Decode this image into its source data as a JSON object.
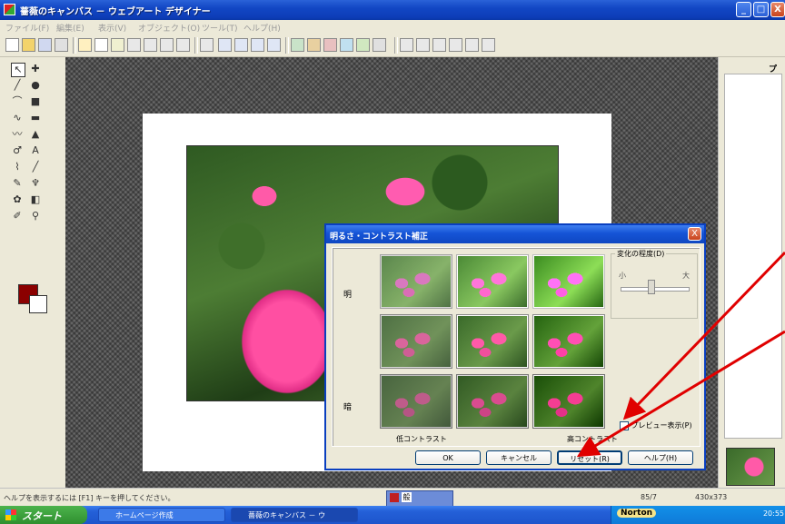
{
  "window": {
    "title": "薔薇のキャンバス － ウェブアート デザイナー",
    "controls": {
      "minimize": "_",
      "maximize": "□",
      "close": "X"
    }
  },
  "menu": [
    "ファイル(F)",
    "編集(E)",
    "表示(V)",
    "オブジェクト(O)",
    "ツール(T)",
    "ヘルプ(H)"
  ],
  "right_panel": {
    "label": "プ"
  },
  "dialog": {
    "title": "明るさ・コントラスト補正",
    "close": "X",
    "row_labels": [
      "明",
      "",
      "暗"
    ],
    "axis_low": "低コントラスト",
    "axis_high": "高コントラスト",
    "change_group_label": "変化の程度(D)",
    "scale_small": "小",
    "scale_large": "大",
    "preview_checkbox": "プレビュー表示(P)",
    "buttons": [
      "OK",
      "キャンセル",
      "リセット(R)",
      "ヘルプ(H)"
    ]
  },
  "status": {
    "text": "ヘルプを表示するには [F1] キーを押してください。",
    "position": "85/7",
    "size": "430x373"
  },
  "ime": {
    "label": "般"
  },
  "taskbar": {
    "start": "スタート",
    "tasks": [
      "ホームページ作成",
      "薔薇のキャンバス － ウ"
    ],
    "tray": {
      "norton": "Norton",
      "clock": "20:55"
    }
  },
  "colors": {
    "foreground": "#8b0000",
    "background": "#ffffff",
    "xp_blue": "#0d3db8",
    "annotation_arrow": "#e00000"
  }
}
